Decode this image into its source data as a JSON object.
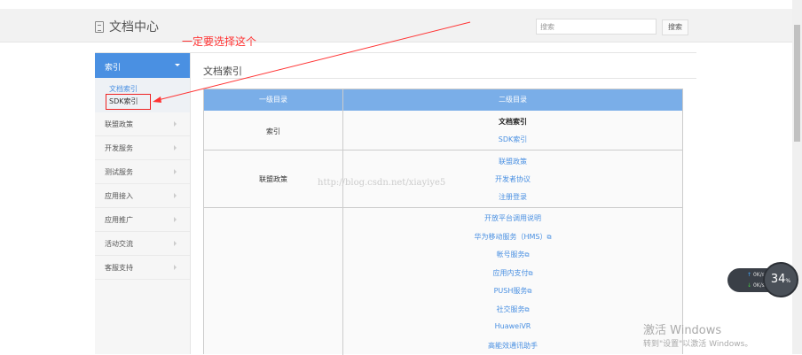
{
  "header": {
    "title": "文档中心",
    "search_placeholder": "搜索",
    "search_button": "搜索"
  },
  "annotation": {
    "text": "一定要选择这个"
  },
  "sidebar": {
    "active": "索引",
    "sub_items": [
      "文档索引",
      "SDK索引"
    ],
    "items": [
      "联盟政策",
      "开发服务",
      "测试服务",
      "应用接入",
      "应用推广",
      "活动交流",
      "客服支持"
    ]
  },
  "content": {
    "title": "文档索引",
    "table": {
      "headers": [
        "一级目录",
        "二级目录"
      ],
      "rows": [
        {
          "level1": "索引",
          "level2": [
            "文档索引",
            "SDK索引"
          ]
        },
        {
          "level1": "联盟政策",
          "level2": [
            "联盟政策",
            "开发者协议",
            "注册登录"
          ]
        },
        {
          "level1": "",
          "level2": [
            "开放平台调用说明",
            "华为移动服务（HMS）",
            "帐号服务",
            "应用内支付",
            "PUSH服务",
            "社交服务",
            "HuaweiVR",
            "高能效通讯助手"
          ]
        }
      ]
    }
  },
  "watermark": "http://blog.csdn.net/xiayiye5",
  "net_widget": {
    "up": "0K/s",
    "down": "0K/s",
    "percent": "34",
    "unit": "%"
  },
  "windows_activation": {
    "title": "激活 Windows",
    "subtitle": "转到\"设置\"以激活 Windows。"
  },
  "colors": {
    "accent": "#4a90e2",
    "table_header": "#7aaee8",
    "annotation": "#ff3333"
  }
}
